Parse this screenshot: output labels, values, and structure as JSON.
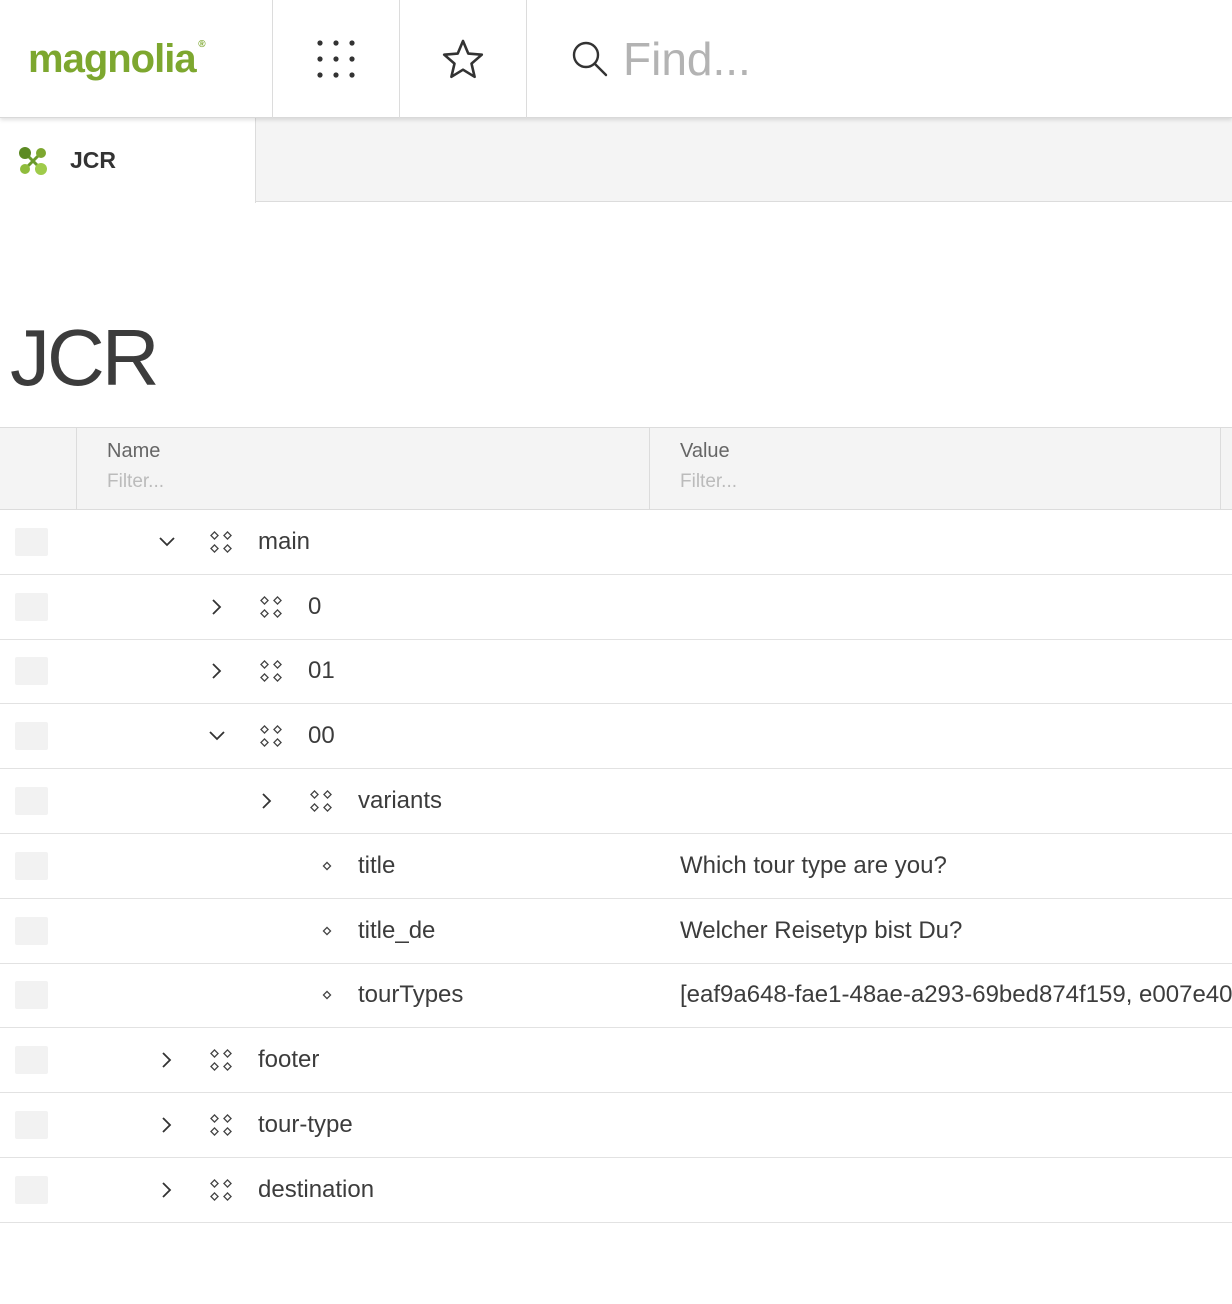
{
  "app": {
    "logo_text": "magnolia",
    "logo_mark": "®",
    "brand_color": "#7da72f",
    "apps_icon": "grid-dots-icon",
    "favorites_icon": "star-icon",
    "search_placeholder": "Find..."
  },
  "tab": {
    "label": "JCR",
    "icon": "jcr-app-icon"
  },
  "page": {
    "title": "JCR"
  },
  "grid": {
    "columns": {
      "name": "Name",
      "name_filter_placeholder": "Filter...",
      "value": "Value",
      "value_filter_placeholder": "Filter..."
    },
    "rows": [
      {
        "name": "main",
        "value": "",
        "type": "node",
        "expanded": true,
        "depth": 0
      },
      {
        "name": "0",
        "value": "",
        "type": "node",
        "expanded": false,
        "depth": 1
      },
      {
        "name": "01",
        "value": "",
        "type": "node",
        "expanded": false,
        "depth": 1
      },
      {
        "name": "00",
        "value": "",
        "type": "node",
        "expanded": true,
        "depth": 1
      },
      {
        "name": "variants",
        "value": "",
        "type": "node",
        "expanded": false,
        "depth": 2
      },
      {
        "name": "title",
        "value": "Which tour type are you?",
        "type": "property",
        "depth": 2
      },
      {
        "name": "title_de",
        "value": "Welcher Reisetyp bist Du?",
        "type": "property",
        "depth": 2
      },
      {
        "name": "tourTypes",
        "value": "[eaf9a648-fae1-48ae-a293-69bed874f159, e007e40",
        "type": "property",
        "depth": 2
      },
      {
        "name": "footer",
        "value": "",
        "type": "node",
        "expanded": false,
        "depth": 0
      },
      {
        "name": "tour-type",
        "value": "",
        "type": "node",
        "expanded": false,
        "depth": 0
      },
      {
        "name": "destination",
        "value": "",
        "type": "node",
        "expanded": false,
        "depth": 0
      }
    ]
  }
}
